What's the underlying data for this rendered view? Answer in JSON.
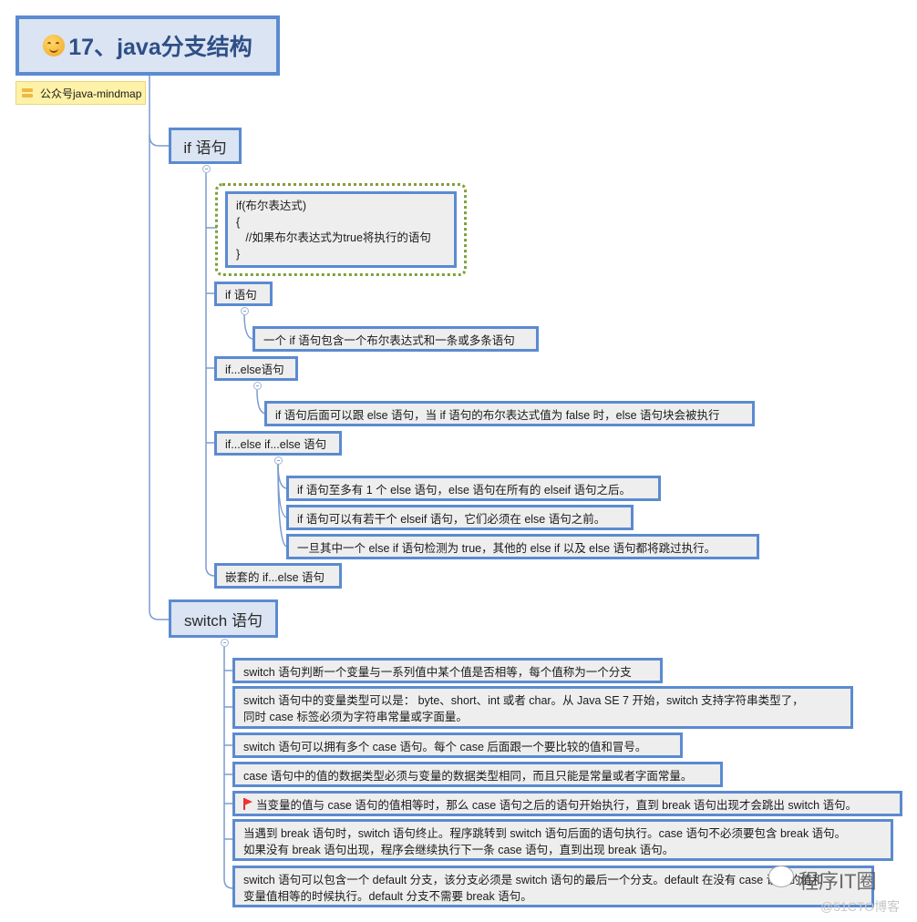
{
  "root": {
    "icon": "smiley-icon",
    "title": "17、java分支结构"
  },
  "note": {
    "icon": "note-icon",
    "label": "公众号java-mindmap"
  },
  "branches": [
    {
      "label": "if 语句",
      "code_block": [
        "if(布尔表达式)",
        "{",
        "   //如果布尔表达式为true将执行的语句",
        "}"
      ],
      "children": [
        {
          "label": "if 语句",
          "details": [
            "一个 if 语句包含一个布尔表达式和一条或多条语句"
          ]
        },
        {
          "label": "if...else语句",
          "details": [
            "if 语句后面可以跟 else 语句，当 if 语句的布尔表达式值为 false 时，else 语句块会被执行"
          ]
        },
        {
          "label": "if...else if...else 语句",
          "details": [
            "if 语句至多有 1 个 else 语句，else 语句在所有的 elseif 语句之后。",
            "if 语句可以有若干个 elseif 语句，它们必须在 else 语句之前。",
            "一旦其中一个 else if 语句检测为 true，其他的 else if 以及 else 语句都将跳过执行。"
          ]
        },
        {
          "label": "嵌套的 if...else 语句"
        }
      ]
    },
    {
      "label": "switch 语句",
      "children": [
        {
          "text": "switch 语句判断一个变量与一系列值中某个值是否相等，每个值称为一个分支"
        },
        {
          "lines": [
            "switch 语句中的变量类型可以是： byte、short、int 或者 char。从 Java SE 7 开始，switch 支持字符串类型了，",
            "同时 case 标签必须为字符串常量或字面量。"
          ]
        },
        {
          "text": "switch 语句可以拥有多个 case 语句。每个 case 后面跟一个要比较的值和冒号。"
        },
        {
          "text": "case 语句中的值的数据类型必须与变量的数据类型相同，而且只能是常量或者字面常量。"
        },
        {
          "icon": "red-flag-icon",
          "text": "当变量的值与 case 语句的值相等时，那么 case 语句之后的语句开始执行，直到 break 语句出现才会跳出 switch 语句。"
        },
        {
          "lines": [
            "当遇到 break 语句时，switch 语句终止。程序跳转到 switch 语句后面的语句执行。case 语句不必须要包含 break 语句。",
            "如果没有 break 语句出现，程序会继续执行下一条 case 语句，直到出现 break 语句。"
          ]
        },
        {
          "lines": [
            "switch 语句可以包含一个 default 分支，该分支必须是 switch 语句的最后一个分支。default 在没有 case 语句的值和",
            "变量值相等的时候执行。default 分支不需要 break 语句。"
          ]
        }
      ]
    }
  ],
  "watermark": {
    "primary": "程序IT圈",
    "secondary": "@51CTO博客"
  }
}
